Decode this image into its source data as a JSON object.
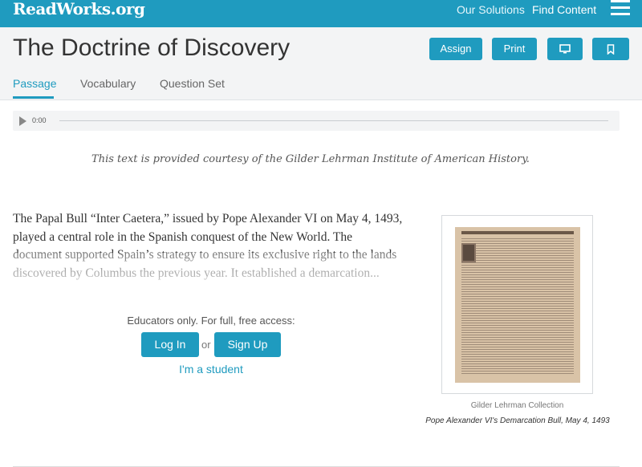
{
  "header": {
    "logo": "ReadWorks.org",
    "nav": [
      "Our Solutions",
      "Find Content"
    ],
    "menu_icon": "hamburger-icon"
  },
  "title": "The Doctrine of Discovery",
  "actions": {
    "assign": "Assign",
    "print": "Print",
    "present_icon": "monitor-icon",
    "bookmark_icon": "bookmark-icon"
  },
  "tabs": [
    {
      "label": "Passage",
      "active": true
    },
    {
      "label": "Vocabulary",
      "active": false
    },
    {
      "label": "Question Set",
      "active": false
    }
  ],
  "audio": {
    "time": "0:00",
    "progress": 0
  },
  "courtesy": "This text is provided courtesy of the Gilder Lehrman Institute of American History.",
  "passage": "The Papal Bull “Inter Caetera,” issued by Pope Alexander VI on May 4, 1493, played a central role in the Spanish conquest of the New World. The document supported Spain’s strategy to ensure its exclusive right to the lands discovered by Columbus the previous year. It established a demarcation...",
  "access": {
    "prompt": "Educators only. For full, free access:",
    "login": "Log In",
    "or": "or",
    "signup": "Sign Up",
    "student": "I'm a student"
  },
  "figure": {
    "credit": "Gilder Lehrman Collection",
    "caption": "Pope Alexander VI's Demarcation Bull, May 4, 1493"
  },
  "colors": {
    "accent": "#1f9bbf",
    "title_bar": "#f3f4f5"
  }
}
